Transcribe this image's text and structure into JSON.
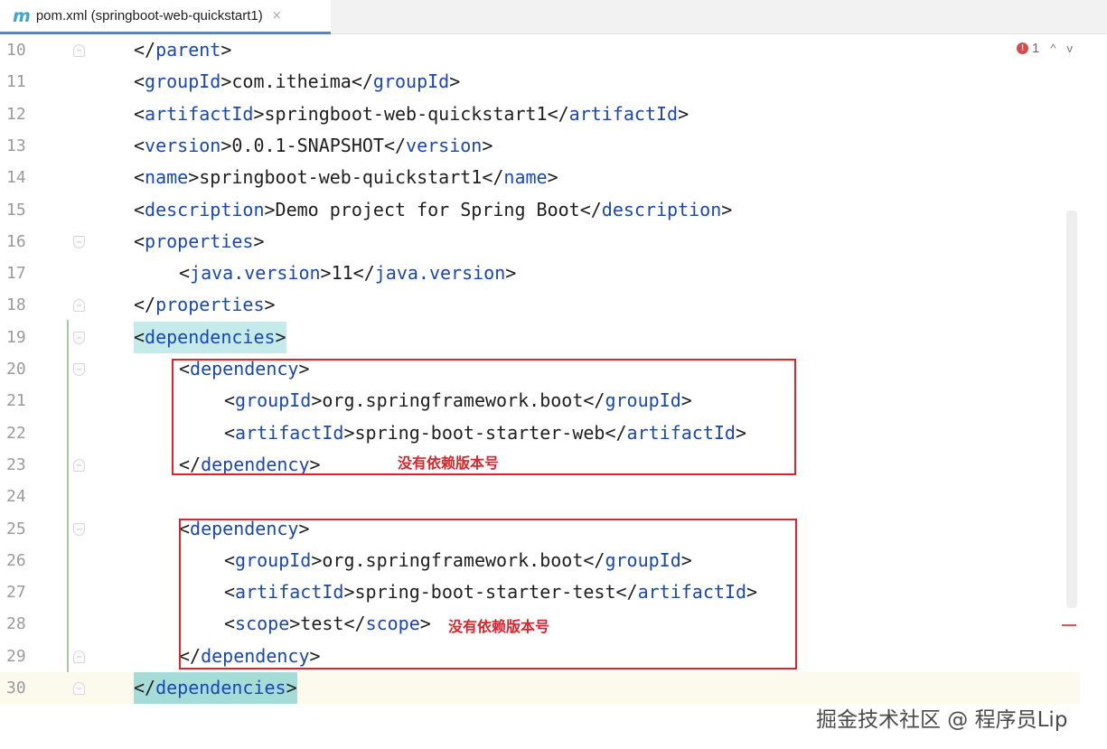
{
  "tab": {
    "icon": "m",
    "title": "pom.xml (springboot-web-quickstart1)",
    "close": "×"
  },
  "inspection": {
    "error_icon": "!",
    "error_count": "1",
    "prev": "^",
    "next": "v"
  },
  "lines": [
    {
      "n": "10",
      "indent": 0,
      "fold": "close",
      "seg": [
        [
          "br",
          "</"
        ],
        [
          "t",
          "parent"
        ],
        [
          "br",
          ">"
        ]
      ]
    },
    {
      "n": "11",
      "indent": 0,
      "fold": "",
      "seg": [
        [
          "br",
          "<"
        ],
        [
          "t",
          "groupId"
        ],
        [
          "br",
          ">com.itheima</"
        ],
        [
          "t",
          "groupId"
        ],
        [
          "br",
          ">"
        ]
      ]
    },
    {
      "n": "12",
      "indent": 0,
      "fold": "",
      "seg": [
        [
          "br",
          "<"
        ],
        [
          "t",
          "artifactId"
        ],
        [
          "br",
          ">springboot-web-quickstart1</"
        ],
        [
          "t",
          "artifactId"
        ],
        [
          "br",
          ">"
        ]
      ]
    },
    {
      "n": "13",
      "indent": 0,
      "fold": "",
      "seg": [
        [
          "br",
          "<"
        ],
        [
          "t",
          "version"
        ],
        [
          "br",
          ">0.0.1-SNAPSHOT</"
        ],
        [
          "t",
          "version"
        ],
        [
          "br",
          ">"
        ]
      ]
    },
    {
      "n": "14",
      "indent": 0,
      "fold": "",
      "seg": [
        [
          "br",
          "<"
        ],
        [
          "t",
          "name"
        ],
        [
          "br",
          ">springboot-web-quickstart1</"
        ],
        [
          "t",
          "name"
        ],
        [
          "br",
          ">"
        ]
      ]
    },
    {
      "n": "15",
      "indent": 0,
      "fold": "",
      "seg": [
        [
          "br",
          "<"
        ],
        [
          "t",
          "description"
        ],
        [
          "br",
          ">Demo project for Spring Boot</"
        ],
        [
          "t",
          "description"
        ],
        [
          "br",
          ">"
        ]
      ]
    },
    {
      "n": "16",
      "indent": 0,
      "fold": "open",
      "seg": [
        [
          "br",
          "<"
        ],
        [
          "t",
          "properties"
        ],
        [
          "br",
          ">"
        ]
      ]
    },
    {
      "n": "17",
      "indent": 1,
      "fold": "",
      "seg": [
        [
          "br",
          "<"
        ],
        [
          "t",
          "java.version"
        ],
        [
          "br",
          ">11</"
        ],
        [
          "t",
          "java.version"
        ],
        [
          "br",
          ">"
        ]
      ]
    },
    {
      "n": "18",
      "indent": 0,
      "fold": "close",
      "seg": [
        [
          "br",
          "</"
        ],
        [
          "t",
          "properties"
        ],
        [
          "br",
          ">"
        ]
      ]
    },
    {
      "n": "19",
      "indent": 0,
      "fold": "open",
      "hl": true,
      "seg": [
        [
          "br",
          "<"
        ],
        [
          "t",
          "dependencies"
        ],
        [
          "br",
          ">"
        ]
      ]
    },
    {
      "n": "20",
      "indent": 1,
      "fold": "open",
      "seg": [
        [
          "br",
          "<"
        ],
        [
          "t",
          "dependency"
        ],
        [
          "br",
          ">"
        ]
      ]
    },
    {
      "n": "21",
      "indent": 2,
      "fold": "",
      "seg": [
        [
          "br",
          "<"
        ],
        [
          "t",
          "groupId"
        ],
        [
          "br",
          ">org.springframework.boot</"
        ],
        [
          "t",
          "groupId"
        ],
        [
          "br",
          ">"
        ]
      ]
    },
    {
      "n": "22",
      "indent": 2,
      "fold": "",
      "seg": [
        [
          "br",
          "<"
        ],
        [
          "t",
          "artifactId"
        ],
        [
          "br",
          ">spring-boot-starter-web</"
        ],
        [
          "t",
          "artifactId"
        ],
        [
          "br",
          ">"
        ]
      ]
    },
    {
      "n": "23",
      "indent": 1,
      "fold": "close",
      "seg": [
        [
          "br",
          "</"
        ],
        [
          "t",
          "dependency"
        ],
        [
          "br",
          ">"
        ]
      ]
    },
    {
      "n": "24",
      "indent": 0,
      "fold": "",
      "seg": []
    },
    {
      "n": "25",
      "indent": 1,
      "fold": "open",
      "seg": [
        [
          "br",
          "<"
        ],
        [
          "t",
          "dependency"
        ],
        [
          "br",
          ">"
        ]
      ]
    },
    {
      "n": "26",
      "indent": 2,
      "fold": "",
      "seg": [
        [
          "br",
          "<"
        ],
        [
          "t",
          "groupId"
        ],
        [
          "br",
          ">org.springframework.boot</"
        ],
        [
          "t",
          "groupId"
        ],
        [
          "br",
          ">"
        ]
      ]
    },
    {
      "n": "27",
      "indent": 2,
      "fold": "",
      "seg": [
        [
          "br",
          "<"
        ],
        [
          "t",
          "artifactId"
        ],
        [
          "br",
          ">spring-boot-starter-test</"
        ],
        [
          "t",
          "artifactId"
        ],
        [
          "br",
          ">"
        ]
      ]
    },
    {
      "n": "28",
      "indent": 2,
      "fold": "",
      "seg": [
        [
          "br",
          "<"
        ],
        [
          "t",
          "scope"
        ],
        [
          "br",
          ">test</"
        ],
        [
          "t",
          "scope"
        ],
        [
          "br",
          ">"
        ]
      ]
    },
    {
      "n": "29",
      "indent": 1,
      "fold": "close",
      "seg": [
        [
          "br",
          "</"
        ],
        [
          "t",
          "dependency"
        ],
        [
          "br",
          ">"
        ]
      ]
    },
    {
      "n": "30",
      "indent": 0,
      "fold": "close",
      "hl": true,
      "current": true,
      "seg": [
        [
          "br",
          "</"
        ],
        [
          "t",
          "dependencies"
        ],
        [
          "br",
          ">"
        ]
      ]
    }
  ],
  "annotations": {
    "note1": "没有依赖版本号",
    "note2": "没有依赖版本号"
  },
  "watermark": "掘金技术社区 @ 程序员Lip",
  "colors": {
    "tag": "#1947b3",
    "annotation": "#e0232b",
    "tab_accent": "#4a86e8",
    "match_highlight": "#c4ebe9"
  }
}
